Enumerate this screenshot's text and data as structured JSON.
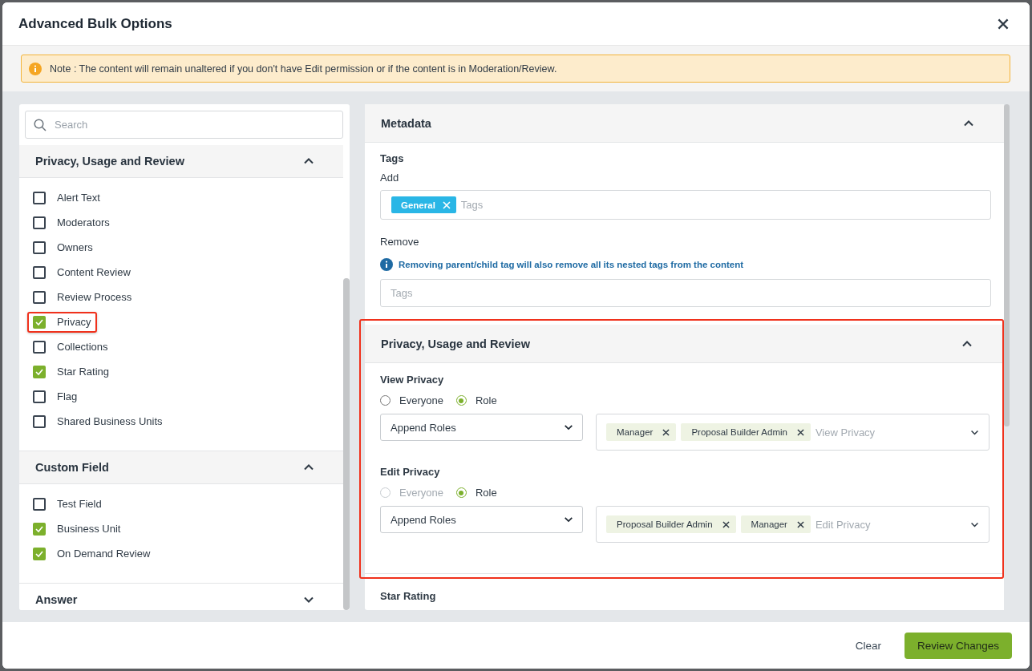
{
  "window": {
    "title": "Advanced Bulk Options"
  },
  "note": {
    "text": "Note : The content will remain unaltered if you don't have Edit permission or if the content is in Moderation/Review."
  },
  "sidebar": {
    "search": {
      "placeholder": "Search"
    },
    "sections": [
      {
        "title": "Privacy, Usage and Review",
        "expanded": true,
        "items": [
          {
            "label": "Alert Text",
            "checked": false,
            "highlighted": false
          },
          {
            "label": "Moderators",
            "checked": false,
            "highlighted": false
          },
          {
            "label": "Owners",
            "checked": false,
            "highlighted": false
          },
          {
            "label": "Content Review",
            "checked": false,
            "highlighted": false
          },
          {
            "label": "Review Process",
            "checked": false,
            "highlighted": false
          },
          {
            "label": "Privacy",
            "checked": true,
            "highlighted": true
          },
          {
            "label": "Collections",
            "checked": false,
            "highlighted": false
          },
          {
            "label": "Star Rating",
            "checked": true,
            "highlighted": false
          },
          {
            "label": "Flag",
            "checked": false,
            "highlighted": false
          },
          {
            "label": "Shared Business Units",
            "checked": false,
            "highlighted": false
          }
        ]
      },
      {
        "title": "Custom Field",
        "expanded": true,
        "items": [
          {
            "label": "Test Field",
            "checked": false,
            "highlighted": false
          },
          {
            "label": "Business Unit",
            "checked": true,
            "highlighted": false
          },
          {
            "label": "On Demand Review",
            "checked": true,
            "highlighted": false
          }
        ]
      },
      {
        "title": "Answer",
        "expanded": false
      }
    ]
  },
  "metadata": {
    "title": "Metadata",
    "expanded": true,
    "tags_label": "Tags",
    "add": {
      "label": "Add",
      "chips": [
        "General"
      ],
      "placeholder": "Tags"
    },
    "remove": {
      "label": "Remove",
      "info": "Removing parent/child tag will also remove all its nested tags from the content",
      "placeholder": "Tags"
    }
  },
  "privacy": {
    "title": "Privacy, Usage and Review",
    "expanded": true,
    "highlighted": true,
    "groups": [
      {
        "label": "View Privacy",
        "options": [
          {
            "label": "Everyone",
            "selected": false,
            "disabled": false
          },
          {
            "label": "Role",
            "selected": true,
            "disabled": false
          }
        ],
        "mode": "Append Roles",
        "roles": [
          "Manager",
          "Proposal Builder Admin"
        ],
        "placeholder": "View Privacy"
      },
      {
        "label": "Edit Privacy",
        "options": [
          {
            "label": "Everyone",
            "selected": false,
            "disabled": true
          },
          {
            "label": "Role",
            "selected": true,
            "disabled": false
          }
        ],
        "mode": "Append Roles",
        "roles": [
          "Proposal Builder Admin",
          "Manager"
        ],
        "placeholder": "Edit Privacy"
      }
    ]
  },
  "star_rating": {
    "title": "Star Rating"
  },
  "footer": {
    "buttons": [
      {
        "label": "Clear",
        "kind": "text"
      },
      {
        "label": "Review Changes",
        "kind": "primary"
      }
    ]
  }
}
